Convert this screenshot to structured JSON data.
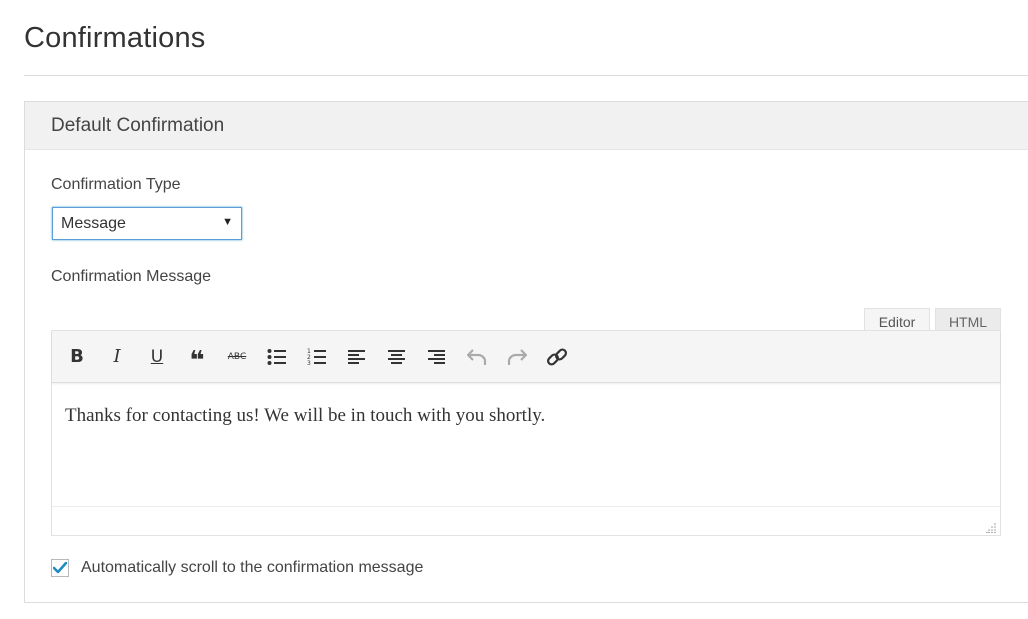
{
  "page": {
    "title": "Confirmations"
  },
  "panel": {
    "title": "Default Confirmation",
    "type_label": "Confirmation Type",
    "type_value": "Message",
    "message_label": "Confirmation Message",
    "tabs": [
      {
        "label": "Editor",
        "active": true
      },
      {
        "label": "HTML",
        "active": false
      }
    ],
    "toolbar": [
      {
        "name": "bold",
        "icon": "bold-icon",
        "glyph": "B"
      },
      {
        "name": "italic",
        "icon": "italic-icon",
        "glyph": "I"
      },
      {
        "name": "underline",
        "icon": "underline-icon",
        "glyph": "U"
      },
      {
        "name": "blockquote",
        "icon": "blockquote-icon",
        "glyph": "❝"
      },
      {
        "name": "strikethrough",
        "icon": "strikethrough-icon",
        "glyph": "ABC"
      },
      {
        "name": "bullet-list",
        "icon": "bullet-list-icon"
      },
      {
        "name": "numbered-list",
        "icon": "numbered-list-icon"
      },
      {
        "name": "align-left",
        "icon": "align-left-icon"
      },
      {
        "name": "align-center",
        "icon": "align-center-icon"
      },
      {
        "name": "align-right",
        "icon": "align-right-icon"
      },
      {
        "name": "undo",
        "icon": "undo-icon",
        "disabled": true
      },
      {
        "name": "redo",
        "icon": "redo-icon",
        "disabled": true
      },
      {
        "name": "link",
        "icon": "link-icon"
      }
    ],
    "message_text": "Thanks for contacting us! We will be in touch with you shortly.",
    "autoscroll": {
      "checked": true,
      "label": "Automatically scroll to the confirmation message"
    }
  },
  "colors": {
    "accent": "#1e8cbe",
    "header_bg": "#f1f1f1",
    "border": "#dcdcdc"
  }
}
